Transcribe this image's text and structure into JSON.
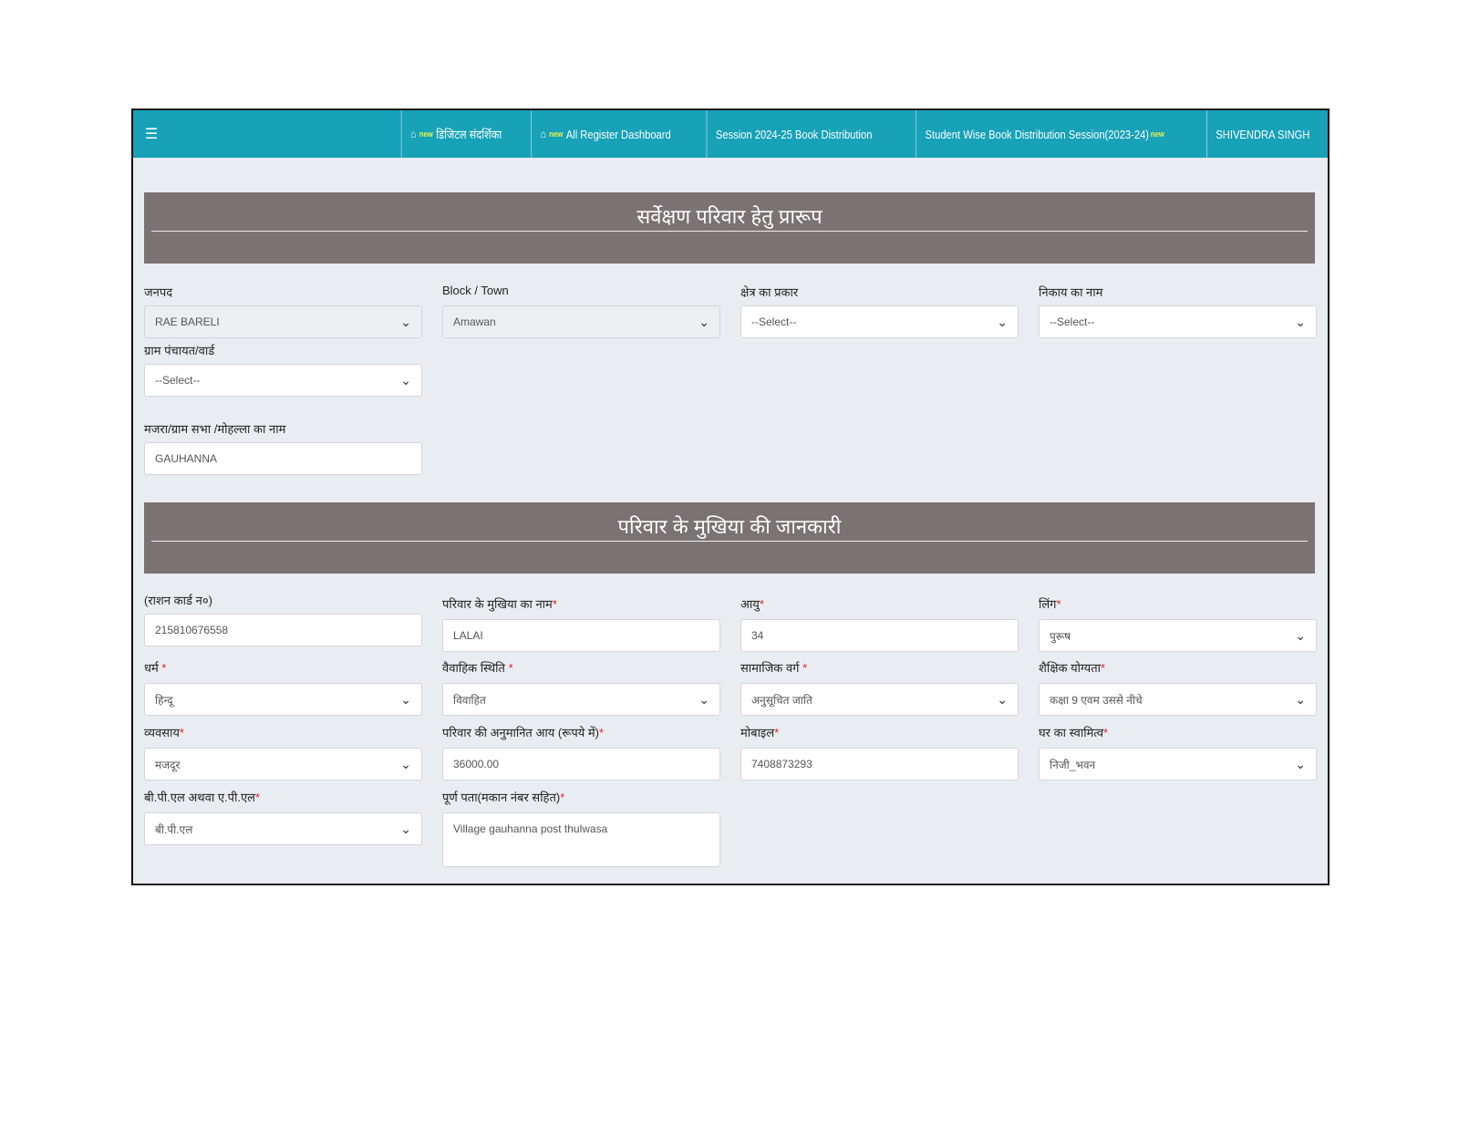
{
  "nav": {
    "items": [
      {
        "label": "डिजिटल संदर्शिका",
        "new": "new"
      },
      {
        "label": "All Register Dashboard",
        "new": "new"
      },
      {
        "label": "Session 2024-25 Book Distribution"
      },
      {
        "label": "Student Wise Book Distribution Session(2023-24)",
        "new": "new"
      }
    ],
    "user": "SHIVENDRA SINGH"
  },
  "section1": {
    "title": "सर्वेक्षण परिवार हेतु प्रारूप",
    "fields": [
      {
        "label": "जनपद",
        "value": "RAE BARELI"
      },
      {
        "label": "Block / Town",
        "value": "Amawan"
      },
      {
        "label": "क्षेत्र का प्रकार",
        "value": "--Select--"
      },
      {
        "label": "निकाय का नाम",
        "value": "--Select--"
      },
      {
        "label": "ग्राम पंचायत/वार्ड",
        "value": "--Select--"
      },
      {
        "label": "मजरा/ग्राम सभा /मोहल्ला का नाम",
        "value": "GAUHANNA"
      }
    ]
  },
  "section2": {
    "title": "परिवार के मुखिया की जानकारी",
    "fields": [
      {
        "label": "(राशन कार्ड न०)",
        "value": "215810676558"
      },
      {
        "label": "परिवार के मुखिया का नाम",
        "value": "LALAI"
      },
      {
        "label": "आयु",
        "value": "34"
      },
      {
        "label": "लिंग",
        "value": "पुरूष"
      },
      {
        "label": "धर्म ",
        "value": "हिन्दू"
      },
      {
        "label": "वैवाहिक स्थिति ",
        "value": "विवाहित"
      },
      {
        "label": "सामाजिक वर्ग ",
        "value": "अनुसूचित जाति"
      },
      {
        "label": "शैक्षिक योग्यता",
        "value": "कक्षा 9 एवम उससे नीचे"
      },
      {
        "label": "व्यवसाय",
        "value": "मजदूर"
      },
      {
        "label": "परिवार की अनुमानित आय (रूपये में)",
        "value": "36000.00"
      },
      {
        "label": "मोबाइल",
        "value": "7408873293"
      },
      {
        "label": "घर का स्वामित्व",
        "value": "निजी_भवन"
      },
      {
        "label": "बी.पी.एल अथवा ए.पी.एल",
        "value": "बी.पी.एल"
      },
      {
        "label": "पूर्ण पता(मकान नंबर सहित)",
        "value": "Village gauhanna post thulwasa"
      }
    ]
  },
  "required_marker": "*"
}
